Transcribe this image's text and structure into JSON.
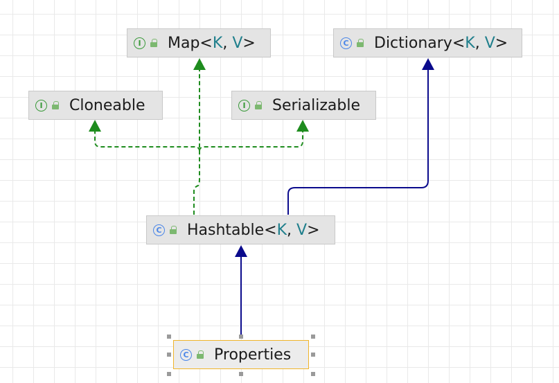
{
  "diagram": {
    "nodes": {
      "map": {
        "kind": "interface",
        "kind_letter": "I",
        "name": "Map<",
        "p1": "K",
        "sep": ", ",
        "p2": "V",
        "close": ">"
      },
      "dictionary": {
        "kind": "class",
        "kind_letter": "C",
        "name": "Dictionary<",
        "p1": "K",
        "sep": ", ",
        "p2": "V",
        "close": ">"
      },
      "cloneable": {
        "kind": "interface",
        "kind_letter": "I",
        "name": "Cloneable"
      },
      "serializable": {
        "kind": "interface",
        "kind_letter": "I",
        "name": "Serializable"
      },
      "hashtable": {
        "kind": "class",
        "kind_letter": "C",
        "name": "Hashtable<",
        "p1": "K",
        "sep": ", ",
        "p2": "V",
        "close": ">"
      },
      "properties": {
        "kind": "class",
        "kind_letter": "C",
        "name": "Properties",
        "selected": true
      }
    },
    "edges": [
      {
        "from": "hashtable",
        "to": "map",
        "relation": "implements",
        "style": "dashed",
        "color": "#1e8c1e"
      },
      {
        "from": "hashtable",
        "to": "cloneable",
        "relation": "implements",
        "style": "dashed",
        "color": "#1e8c1e"
      },
      {
        "from": "hashtable",
        "to": "serializable",
        "relation": "implements",
        "style": "dashed",
        "color": "#1e8c1e"
      },
      {
        "from": "hashtable",
        "to": "dictionary",
        "relation": "extends",
        "style": "solid",
        "color": "#0a0a8c"
      },
      {
        "from": "properties",
        "to": "hashtable",
        "relation": "extends",
        "style": "solid",
        "color": "#0a0a8c"
      }
    ]
  }
}
